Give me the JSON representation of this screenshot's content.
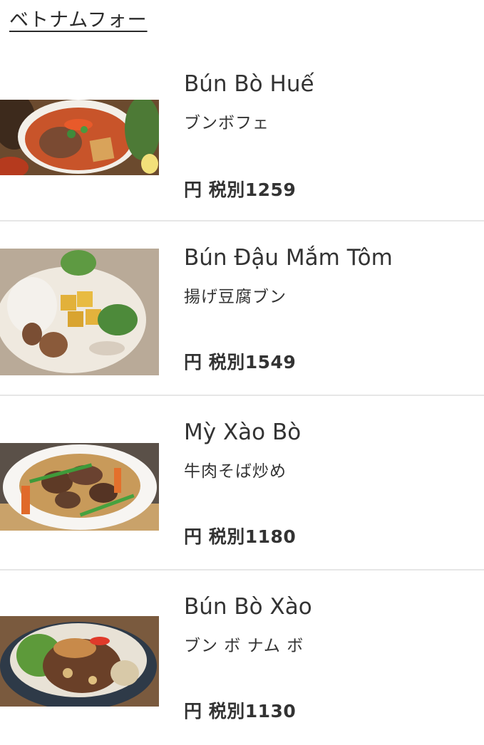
{
  "category": {
    "title": "ベトナムフォー"
  },
  "items": [
    {
      "name": "Bún Bò Huế",
      "subtitle": "ブンボフェ",
      "currency": "円",
      "tax_label": "税別",
      "price": "1259",
      "photo_icon": "bun-bo-hue-photo"
    },
    {
      "name": "Bún Đậu Mắm Tôm",
      "subtitle": "揚げ豆腐ブン",
      "currency": "円",
      "tax_label": "税別",
      "price": "1549",
      "photo_icon": "bun-dau-mam-tom-photo"
    },
    {
      "name": "Mỳ Xào Bò",
      "subtitle": "牛肉そば炒め",
      "currency": "円",
      "tax_label": "税別",
      "price": "1180",
      "photo_icon": "my-xao-bo-photo"
    },
    {
      "name": "Bún Bò Xào",
      "subtitle": "ブン ボ ナム ボ",
      "currency": "円",
      "tax_label": "税別",
      "price": "1130",
      "photo_icon": "bun-bo-xao-photo"
    }
  ]
}
